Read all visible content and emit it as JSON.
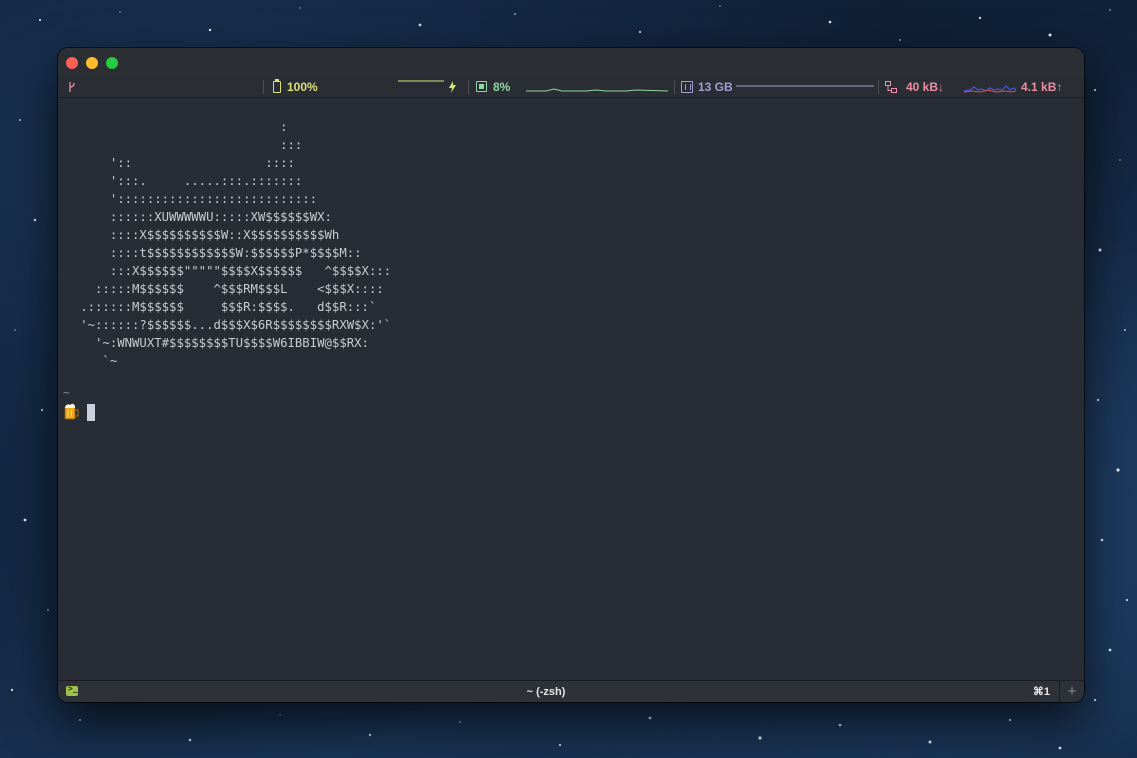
{
  "status_bar": {
    "git_icon": "git-branch-icon",
    "battery": {
      "icon": "battery-icon",
      "value": "100%",
      "charging_icon": "lightning-icon",
      "color": "#d7e27c"
    },
    "cpu": {
      "icon": "cpu-icon",
      "value": "8%",
      "color": "#8fd8a0"
    },
    "memory": {
      "icon": "memory-icon",
      "value": "13 GB",
      "color": "#a79bd6"
    },
    "network": {
      "icon": "network-icon",
      "down": "40 kB↓",
      "up": "4.1 kB↑",
      "color": "#e88ea5"
    }
  },
  "terminal": {
    "art_lines": [
      "                              :",
      "                              :::",
      "       '::                  ::::",
      "       ':::.     .....:::.:::::::",
      "       ':::::::::::::::::::::::::::",
      "       ::::::XUWWWWWU:::::XW$$$$$$WX:",
      "       ::::X$$$$$$$$$$W::X$$$$$$$$$$Wh",
      "       ::::t$$$$$$$$$$$$W:$$$$$$P*$$$$M::",
      "       :::X$$$$$$\"\"\"\"\"$$$$X$$$$$$   ^$$$$X:::",
      "     :::::M$$$$$$    ^$$$RM$$$L    <$$$X::::",
      "   .::::::M$$$$$$     $$$R:$$$$.   d$$R:::`",
      "   '~::::::?$$$$$$...d$$$X$6R$$$$$$$$RXW$X:'`",
      "     '~:WNWUXT#$$$$$$$$TU$$$$W6IBBIW@$$RX:",
      "      `~"
    ],
    "prompt_dir": "~",
    "prompt_icon": "beer-mug-icon"
  },
  "tab_bar": {
    "icon": "terminal-icon",
    "title": "~ (-zsh)",
    "shortcut": "⌘1",
    "add_label": "+"
  }
}
